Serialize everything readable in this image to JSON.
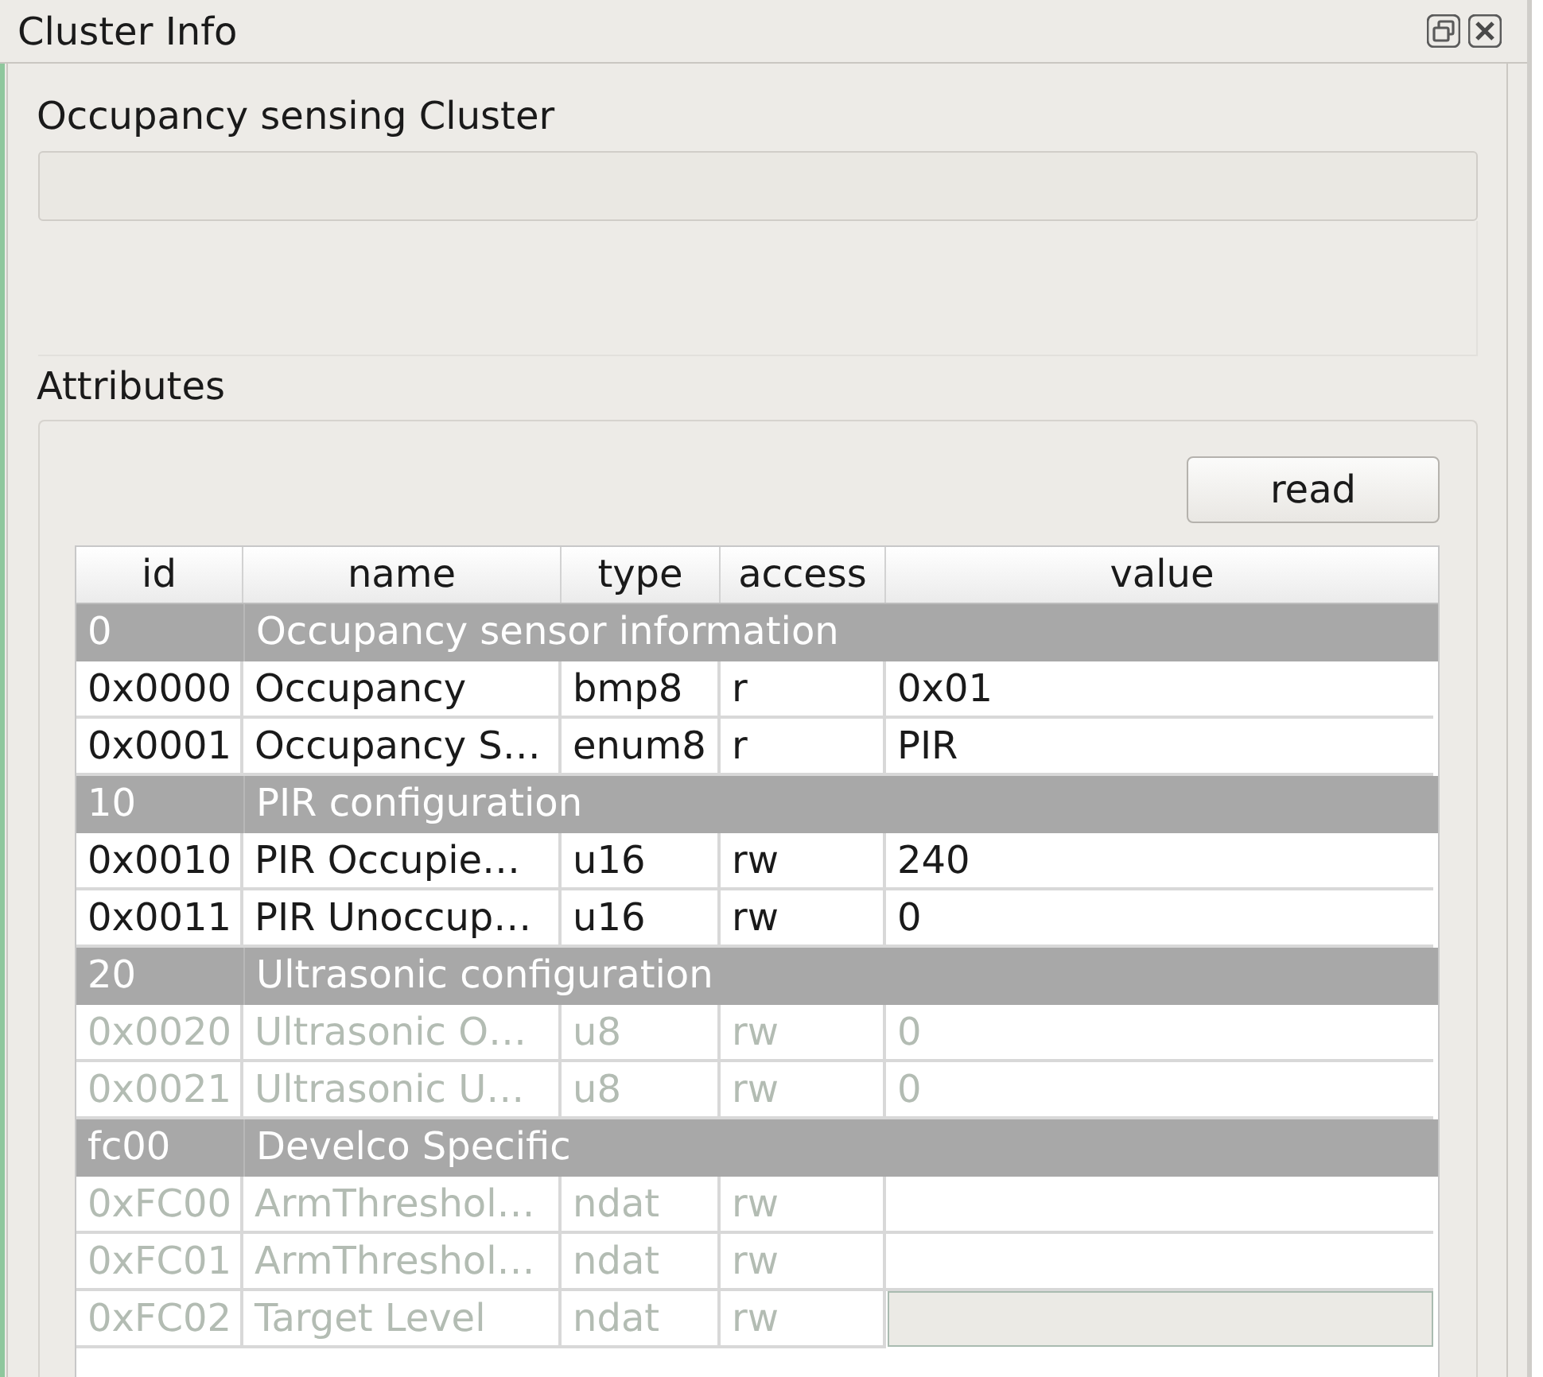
{
  "window": {
    "title": "Cluster Info"
  },
  "cluster": {
    "title": "Occupancy sensing Cluster"
  },
  "attributes": {
    "title": "Attributes",
    "read_button": "read",
    "columns": [
      "id",
      "name",
      "type",
      "access",
      "value"
    ],
    "rows": [
      {
        "kind": "section",
        "id": "0",
        "name": "Occupancy sensor information"
      },
      {
        "kind": "attribute",
        "id": "0x0000",
        "name": "Occupancy",
        "type": "bmp8",
        "access": "r",
        "value": "0x01",
        "disabled": false,
        "editor": false
      },
      {
        "kind": "attribute",
        "id": "0x0001",
        "name": "Occupancy S…",
        "type": "enum8",
        "access": "r",
        "value": "PIR",
        "disabled": false,
        "editor": false
      },
      {
        "kind": "section",
        "id": "10",
        "name": "PIR configuration"
      },
      {
        "kind": "attribute",
        "id": "0x0010",
        "name": "PIR Occupie…",
        "type": "u16",
        "access": "rw",
        "value": "240",
        "disabled": false,
        "editor": false
      },
      {
        "kind": "attribute",
        "id": "0x0011",
        "name": "PIR Unoccup…",
        "type": "u16",
        "access": "rw",
        "value": "0",
        "disabled": false,
        "editor": false
      },
      {
        "kind": "section",
        "id": "20",
        "name": "Ultrasonic configuration"
      },
      {
        "kind": "attribute",
        "id": "0x0020",
        "name": "Ultrasonic O…",
        "type": "u8",
        "access": "rw",
        "value": "0",
        "disabled": true,
        "editor": false
      },
      {
        "kind": "attribute",
        "id": "0x0021",
        "name": "Ultrasonic U…",
        "type": "u8",
        "access": "rw",
        "value": "0",
        "disabled": true,
        "editor": false
      },
      {
        "kind": "section",
        "id": "fc00",
        "name": "Develco Specific"
      },
      {
        "kind": "attribute",
        "id": "0xFC00",
        "name": "ArmThreshol…",
        "type": "ndat",
        "access": "rw",
        "disabled": true,
        "editor": false
      },
      {
        "kind": "attribute",
        "id": "0xFC01",
        "name": "ArmThreshol…",
        "type": "ndat",
        "access": "rw",
        "disabled": true,
        "editor": false
      },
      {
        "kind": "attribute",
        "id": "0xFC02",
        "name": "Target Level",
        "type": "ndat",
        "access": "rw",
        "disabled": true,
        "editor": true
      }
    ]
  }
}
